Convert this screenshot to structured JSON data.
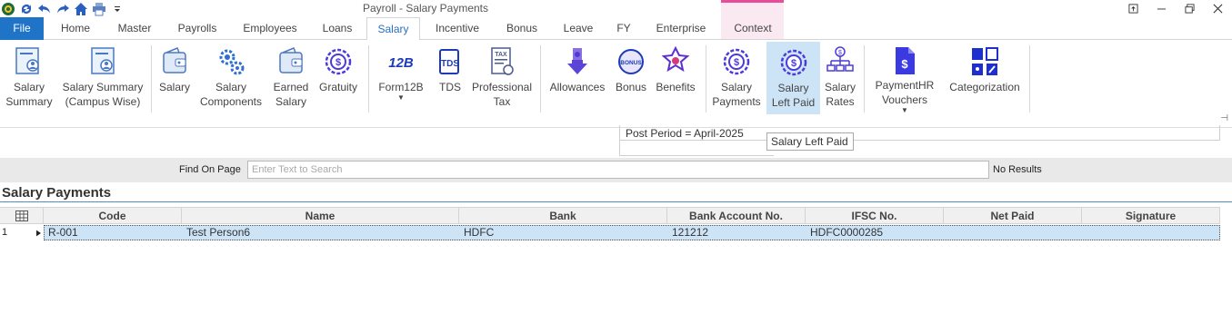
{
  "window": {
    "title": "Payroll - Salary Payments",
    "quick_access_icons": [
      "app-logo-icon",
      "refresh-icon",
      "undo-icon",
      "redo-icon",
      "home-icon",
      "print-icon",
      "customize-dropdown-icon"
    ],
    "controls": [
      "restore-icon",
      "minimize-icon",
      "maximize-icon",
      "close-icon"
    ]
  },
  "tabs": [
    "File",
    "Home",
    "Master",
    "Payrolls",
    "Employees",
    "Loans",
    "Salary",
    "Incentive",
    "Bonus",
    "Leave",
    "FY",
    "Enterprise",
    "Context"
  ],
  "active_tab": "Salary",
  "ribbon": {
    "salary_summary": "Salary\nSummary",
    "salary_summary_campus": "Salary Summary\n(Campus Wise)",
    "salary": "Salary",
    "salary_components": "Salary\nComponents",
    "earned_salary": "Earned\nSalary",
    "gratuity": "Gratuity",
    "form12b": "Form12B",
    "tds": "TDS",
    "professional_tax": "Professional\nTax",
    "allowances": "Allowances",
    "bonus": "Bonus",
    "benefits": "Benefits",
    "salary_payments": "Salary\nPayments",
    "salary_left_paid": "Salary\nLeft Paid",
    "salary_rates": "Salary\nRates",
    "paymenthr_vouchers": "PaymentHR\nVouchers",
    "categorization": "Categorization",
    "icon_text": {
      "form12b": "12B",
      "tds": "TDS",
      "tax": "TAX",
      "bonus_badge": "BONUS"
    }
  },
  "post_period": "Post Period = April-2025",
  "tooltip": "Salary Left Paid",
  "find": {
    "label": "Find On Page",
    "placeholder": "Enter Text to Search",
    "result": "No Results"
  },
  "grid": {
    "title": "Salary Payments",
    "columns": [
      "Code",
      "Name",
      "Bank",
      "Bank Account No.",
      "IFSC No.",
      "Net Paid",
      "Signature"
    ],
    "rows": [
      {
        "row_number": "1",
        "code": "R-001",
        "name": "Test Person6",
        "bank": "HDFC",
        "bank_account": "121212",
        "ifsc": "HDFC0000285",
        "net_paid": "",
        "signature": ""
      }
    ]
  },
  "colors": {
    "file_tab": "#1f74c7",
    "accent_blue": "#2b6fc0",
    "context_band": "#e84d99",
    "selected_row": "#cde4f7",
    "icon_purple": "#4b3bdb"
  }
}
